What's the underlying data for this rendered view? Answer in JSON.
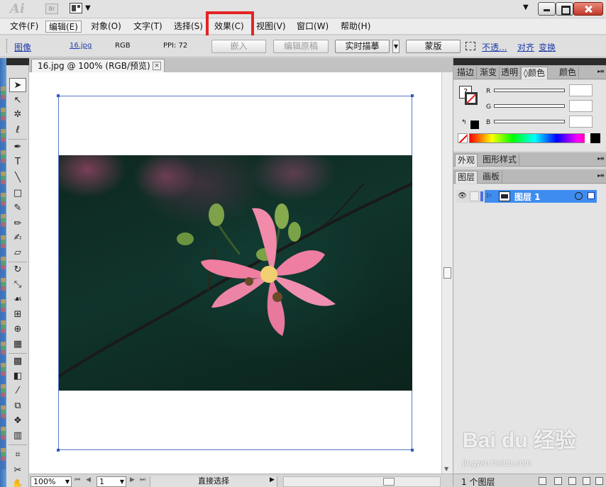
{
  "titlebar": {
    "logo": "Ai",
    "bridge_badge": "Br"
  },
  "menu": [
    "文件(F)",
    "编辑(E)",
    "对象(O)",
    "文字(T)",
    "选择(S)",
    "效果(C)",
    "视图(V)",
    "窗口(W)",
    "帮助(H)"
  ],
  "control_bar": {
    "object_type": "图像",
    "file_link": "16.jpg",
    "color_mode": "RGB",
    "ppi": "PPI: 72",
    "embed_label": "嵌入",
    "edit_original_label": "编辑原稿",
    "live_trace_label": "实时描摹",
    "mask_label": "蒙版",
    "opacity_link": "不透...",
    "align_link": "对齐",
    "transform_link": "变换"
  },
  "document": {
    "tab_title": "16.jpg @ 100% (RGB/预览)",
    "tab_close": "×"
  },
  "status_bar": {
    "zoom": "100%",
    "artboard_number": "1",
    "current_tool": "直接选择"
  },
  "panels": {
    "color_group_tabs": [
      "描边",
      "渐变",
      "透明",
      "颜色",
      "颜色"
    ],
    "color_group_active_prefix": "◊",
    "channels": [
      "R",
      "G",
      "B"
    ],
    "fill_glyph": "?",
    "swap_glyph": "↰",
    "appearance_tabs": [
      "外观",
      "图形样式"
    ],
    "layers_tabs": [
      "图层",
      "画板"
    ],
    "layer_name": "图层 1",
    "layers_count": "1 个图层",
    "accent_color": "#3f8cf0"
  },
  "watermark": {
    "brand": "Bai du 经验",
    "url": "jingyan.baidu.com"
  }
}
